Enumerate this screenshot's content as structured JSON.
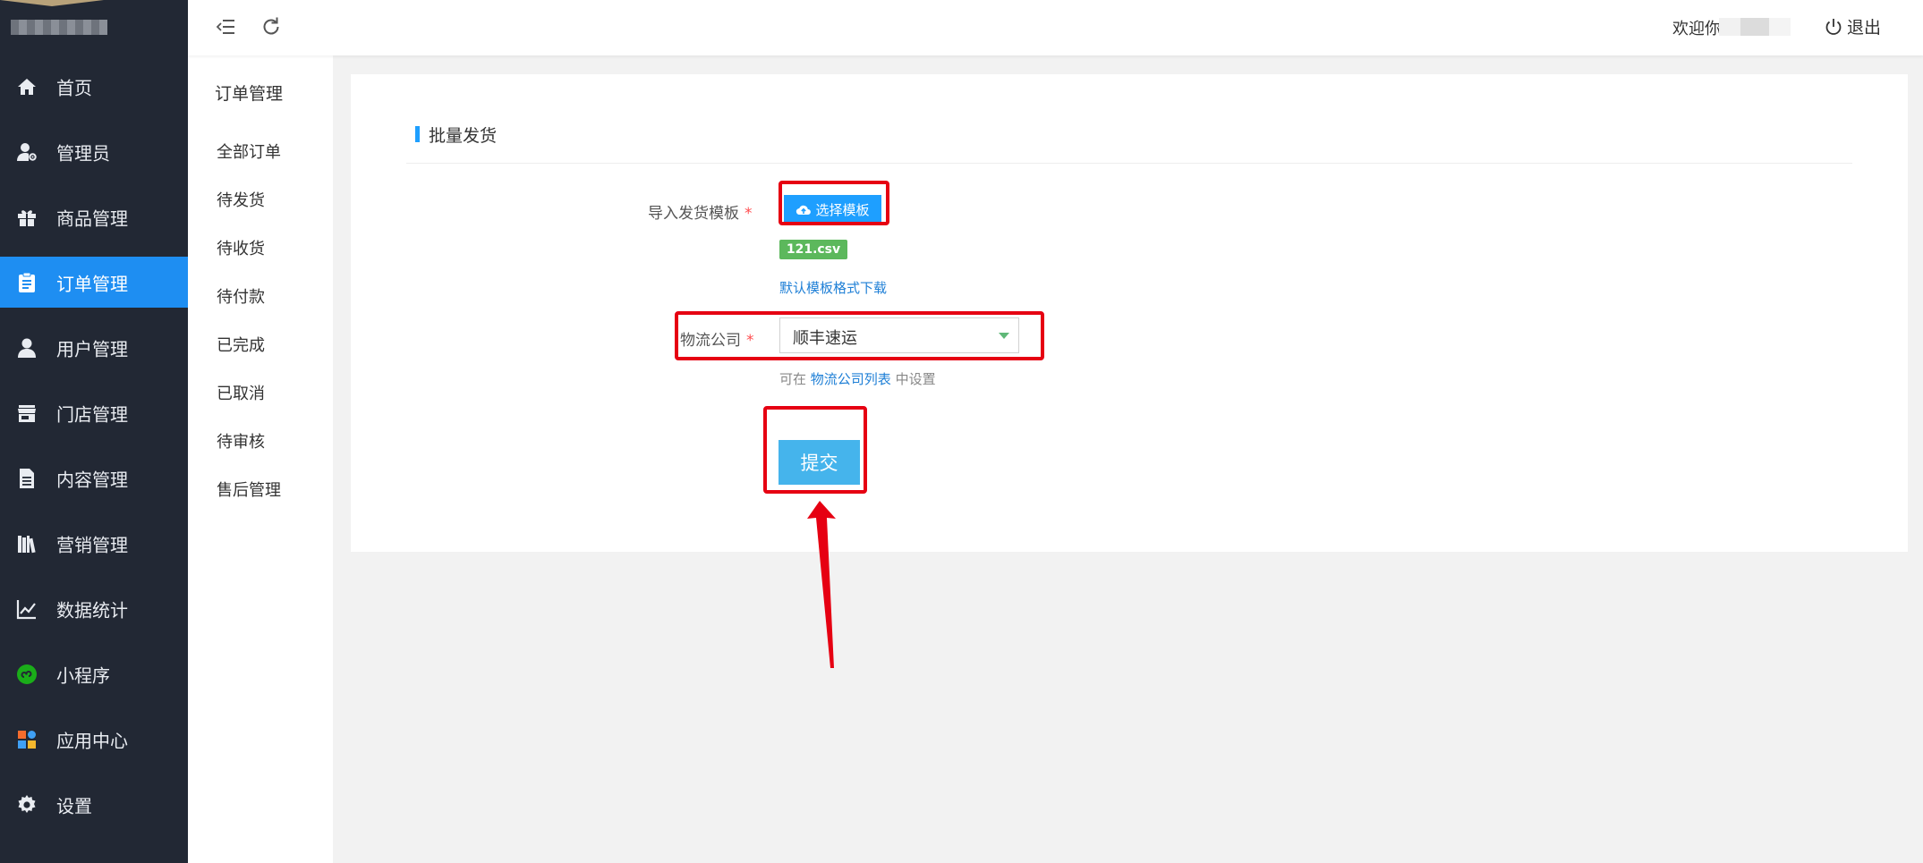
{
  "header": {
    "welcome_text": "欢迎你",
    "logout_label": "退出",
    "icons": [
      "menu-collapse-icon",
      "refresh-icon",
      "power-icon"
    ]
  },
  "sidebar": {
    "items": [
      {
        "label": "首页",
        "icon": "home-icon",
        "active": false
      },
      {
        "label": "管理员",
        "icon": "admin-user-icon",
        "active": false
      },
      {
        "label": "商品管理",
        "icon": "gift-icon",
        "active": false
      },
      {
        "label": "订单管理",
        "icon": "clipboard-icon",
        "active": true
      },
      {
        "label": "用户管理",
        "icon": "user-icon",
        "active": false
      },
      {
        "label": "门店管理",
        "icon": "store-icon",
        "active": false
      },
      {
        "label": "内容管理",
        "icon": "document-icon",
        "active": false
      },
      {
        "label": "营销管理",
        "icon": "books-icon",
        "active": false
      },
      {
        "label": "数据统计",
        "icon": "line-chart-icon",
        "active": false
      },
      {
        "label": "小程序",
        "icon": "mini-program-icon",
        "active": false
      },
      {
        "label": "应用中心",
        "icon": "apps-icon",
        "active": false
      },
      {
        "label": "设置",
        "icon": "gear-icon",
        "active": false
      }
    ],
    "active_color": "#1e8ef2",
    "background": "#222834"
  },
  "submenu": {
    "title": "订单管理",
    "items": [
      "全部订单",
      "待发货",
      "待收货",
      "待付款",
      "已完成",
      "已取消",
      "待审核",
      "售后管理"
    ]
  },
  "main": {
    "section_title": "批量发货",
    "import_label": "导入发货模板",
    "required_mark": "*",
    "choose_button_label": "选择模板",
    "uploaded_file": "121.csv",
    "template_link": "默认模板格式下载",
    "logistics_label": "物流公司",
    "logistics_selected": "顺丰速运",
    "hint_prefix": "可在",
    "hint_link": "物流公司列表",
    "hint_suffix": "中设置",
    "submit_label": "提交"
  },
  "colors": {
    "primary": "#1e9fff",
    "file_badge": "#5cb85c",
    "annotation": "#e60012"
  }
}
